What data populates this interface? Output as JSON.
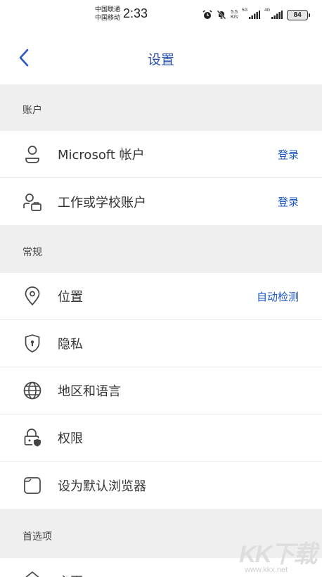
{
  "status_bar": {
    "carrier_1": "中国联通",
    "carrier_2": "中国移动",
    "time": "2:33",
    "speed_value": "5.5",
    "speed_unit": "K/s",
    "net_1": "5G",
    "net_2": "4G",
    "battery": "84"
  },
  "header": {
    "title": "设置"
  },
  "sections": {
    "account": {
      "title": "账户"
    },
    "general": {
      "title": "常规"
    },
    "preferences": {
      "title": "首选项"
    }
  },
  "rows": {
    "microsoft_account": {
      "label": "Microsoft 帐户",
      "action": "登录"
    },
    "work_school_account": {
      "label": "工作或学校账户",
      "action": "登录"
    },
    "location": {
      "label": "位置",
      "action": "自动检测"
    },
    "privacy": {
      "label": "隐私"
    },
    "region_language": {
      "label": "地区和语言"
    },
    "permissions": {
      "label": "权限"
    },
    "default_browser": {
      "label": "设为默认浏览器"
    },
    "home": {
      "label": "主页"
    }
  },
  "watermark": {
    "logo": "KK下载",
    "url": "www.kkx.net"
  },
  "colors": {
    "accent": "#1a57c9",
    "title": "#2a4fae",
    "section_bg": "#efefef"
  }
}
